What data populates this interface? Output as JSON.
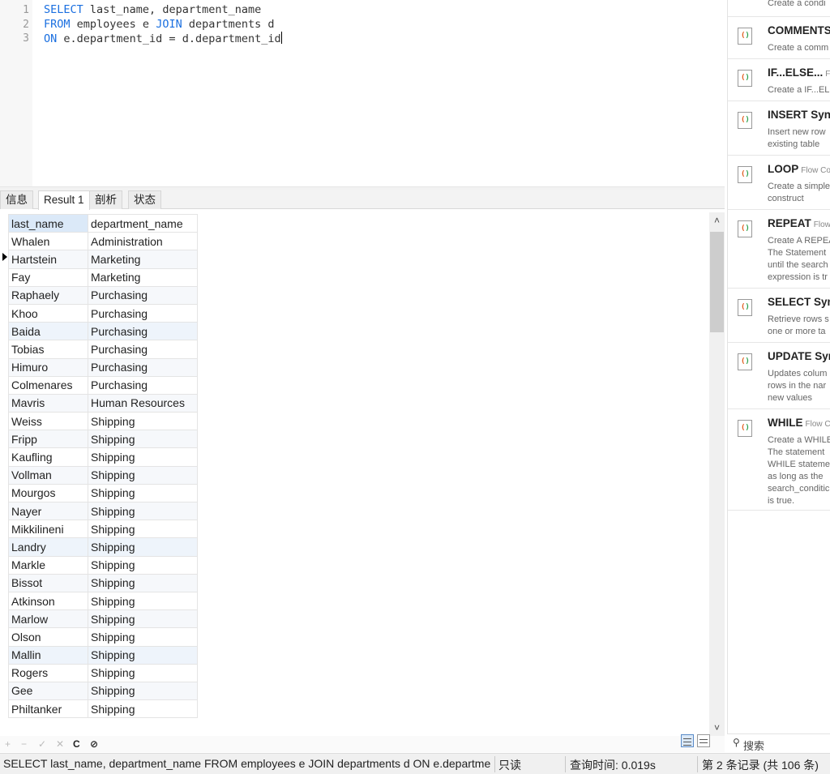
{
  "editor": {
    "line_numbers": [
      "1",
      "2",
      "3"
    ],
    "lines": [
      [
        {
          "t": "SELECT",
          "kw": true
        },
        {
          "t": " last_name, department_name",
          "kw": false
        }
      ],
      [
        {
          "t": "FROM",
          "kw": true
        },
        {
          "t": " employees e ",
          "kw": false
        },
        {
          "t": "JOIN",
          "kw": true
        },
        {
          "t": " departments d",
          "kw": false
        }
      ],
      [
        {
          "t": "ON",
          "kw": true
        },
        {
          "t": " e.department_id = d.department_id",
          "kw": false
        }
      ]
    ]
  },
  "tabs": [
    "信息",
    "Result 1",
    "剖析",
    "状态"
  ],
  "grid": {
    "columns": [
      "last_name",
      "department_name"
    ],
    "rows": [
      [
        "Whalen",
        "Administration"
      ],
      [
        "Hartstein",
        "Marketing"
      ],
      [
        "Fay",
        "Marketing"
      ],
      [
        "Raphaely",
        "Purchasing"
      ],
      [
        "Khoo",
        "Purchasing"
      ],
      [
        "Baida",
        "Purchasing"
      ],
      [
        "Tobias",
        "Purchasing"
      ],
      [
        "Himuro",
        "Purchasing"
      ],
      [
        "Colmenares",
        "Purchasing"
      ],
      [
        "Mavris",
        "Human Resources"
      ],
      [
        "Weiss",
        "Shipping"
      ],
      [
        "Fripp",
        "Shipping"
      ],
      [
        "Kaufling",
        "Shipping"
      ],
      [
        "Vollman",
        "Shipping"
      ],
      [
        "Mourgos",
        "Shipping"
      ],
      [
        "Nayer",
        "Shipping"
      ],
      [
        "Mikkilineni",
        "Shipping"
      ],
      [
        "Landry",
        "Shipping"
      ],
      [
        "Markle",
        "Shipping"
      ],
      [
        "Bissot",
        "Shipping"
      ],
      [
        "Atkinson",
        "Shipping"
      ],
      [
        "Marlow",
        "Shipping"
      ],
      [
        "Olson",
        "Shipping"
      ],
      [
        "Mallin",
        "Shipping"
      ],
      [
        "Rogers",
        "Shipping"
      ],
      [
        "Gee",
        "Shipping"
      ],
      [
        "Philtanker",
        "Shipping"
      ]
    ],
    "selected_row_index": 1
  },
  "toolbar": {
    "add": "+",
    "remove": "−",
    "apply": "✓",
    "discard": "✕",
    "refresh": "C",
    "stop": "⊘"
  },
  "status": {
    "sql": "SELECT last_name, department_name FROM employees e JOIN departments d ON e.departme",
    "mode": "只读",
    "query_time": "查询时间: 0.019s",
    "record": "第 2 条记录 (共 106 条)"
  },
  "snippets": [
    {
      "title": "",
      "tag": "",
      "desc": "Create a condi"
    },
    {
      "title": "COMMENTS",
      "tag": "",
      "desc": "Create a comm"
    },
    {
      "title": "IF...ELSE...",
      "tag": "Flo",
      "desc": "Create a IF...ELS"
    },
    {
      "title": "INSERT Syn",
      "tag": "",
      "desc": "Insert new row\nexisting table"
    },
    {
      "title": "LOOP",
      "tag": "Flow Co",
      "desc": "Create a simple\nconstruct"
    },
    {
      "title": "REPEAT",
      "tag": "Flow",
      "desc": "Create A REPEA\nThe Statement\nuntil the search\nexpression is tr"
    },
    {
      "title": "SELECT Syn",
      "tag": "",
      "desc": "Retrieve rows s\none or more ta"
    },
    {
      "title": "UPDATE Syn",
      "tag": "",
      "desc": "Updates colum\nrows in the nar\nnew values"
    },
    {
      "title": "WHILE",
      "tag": "Flow C",
      "desc": "Create a WHILE\nThe statement\nWHILE stateme\nas long as the\nsearch_conditic\nis true."
    }
  ],
  "search": {
    "icon": "search-icon",
    "label": "搜索"
  }
}
